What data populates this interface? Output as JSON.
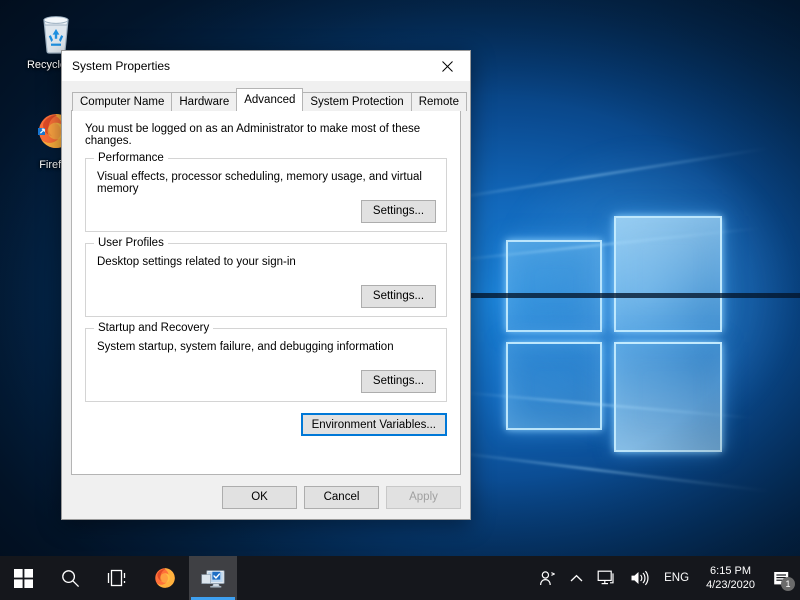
{
  "desktop": {
    "icons": [
      {
        "name": "recycle-bin",
        "label": "Recycle Bin"
      },
      {
        "name": "firefox",
        "label": "Firefox"
      }
    ]
  },
  "dialog": {
    "title": "System Properties",
    "close_label": "Close",
    "tabs": [
      {
        "label": "Computer Name",
        "active": false
      },
      {
        "label": "Hardware",
        "active": false
      },
      {
        "label": "Advanced",
        "active": true
      },
      {
        "label": "System Protection",
        "active": false
      },
      {
        "label": "Remote",
        "active": false
      }
    ],
    "intro": "You must be logged on as an Administrator to make most of these changes.",
    "groups": [
      {
        "title": "Performance",
        "description": "Visual effects, processor scheduling, memory usage, and virtual memory",
        "button": "Settings..."
      },
      {
        "title": "User Profiles",
        "description": "Desktop settings related to your sign-in",
        "button": "Settings..."
      },
      {
        "title": "Startup and Recovery",
        "description": "System startup, system failure, and debugging information",
        "button": "Settings..."
      }
    ],
    "environment_variables_button": "Environment Variables...",
    "footer": {
      "ok": "OK",
      "cancel": "Cancel",
      "apply": "Apply"
    }
  },
  "taskbar": {
    "start_label": "Start",
    "search_label": "Search",
    "taskview_label": "Task View",
    "apps": [
      {
        "name": "firefox",
        "label": "Firefox",
        "active": false
      },
      {
        "name": "system-properties",
        "label": "System Properties",
        "active": true
      }
    ],
    "tray": {
      "people_label": "People",
      "show_hidden_label": "Show hidden icons",
      "network_label": "Network",
      "volume_label": "Volume",
      "language": "ENG",
      "time": "6:15 PM",
      "date": "4/23/2020",
      "notification_count": "1"
    }
  },
  "colors": {
    "accent": "#0078d7",
    "taskbar": "#15171c",
    "dialog_face": "#f0f0f0",
    "panel": "#ffffff",
    "active_underline": "#3ea0f0"
  }
}
